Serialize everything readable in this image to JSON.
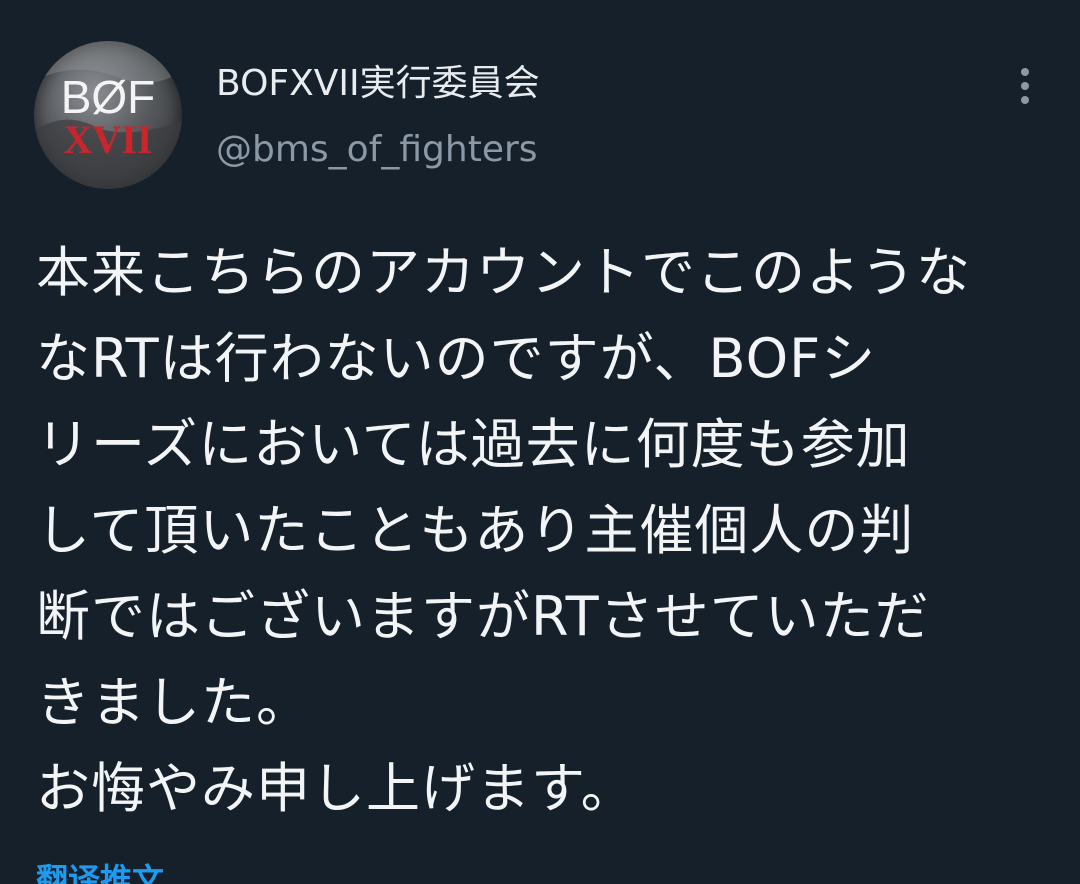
{
  "tweet": {
    "avatar_text_top": "BØF",
    "avatar_text_bottom": "XVII",
    "display_name": "BOFXVII実行委員会",
    "handle": "@bms_of_fighters",
    "body": "本来こちらのアカウントでこのような\nなRTは行わないのですが、BOFシ\nリーズにおいては過去に何度も参加\nして頂いたこともあり主催個人の判\n断ではございますがRTさせていただ\nきました。\nお悔やみ申し上げます。",
    "translate_label": "翻译推文"
  },
  "icons": {
    "more": "more-vertical-icon"
  },
  "colors": {
    "background": "#15202b",
    "text": "#f2f4f5",
    "secondary": "#8b98a5",
    "link": "#1d9bf0",
    "logo_red": "#c8262c"
  }
}
